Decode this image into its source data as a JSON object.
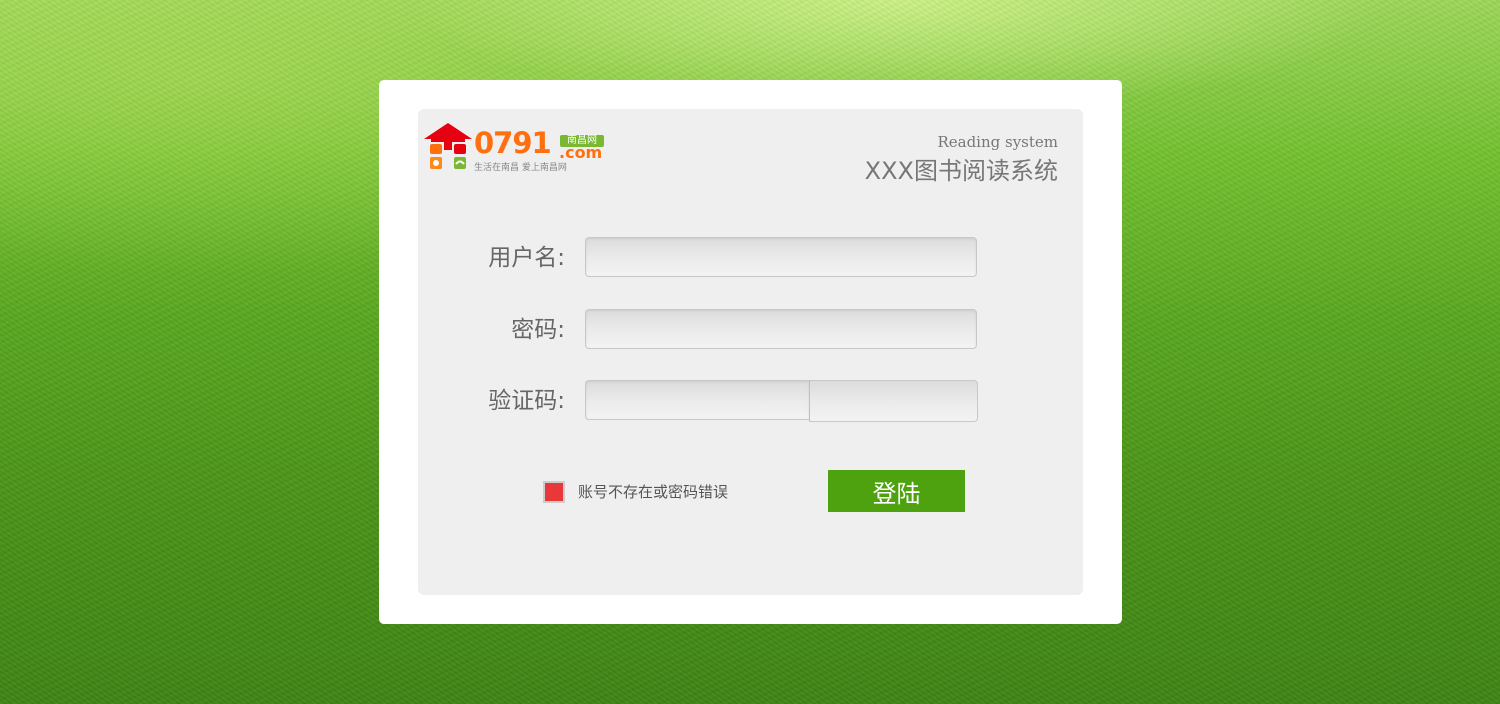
{
  "logo": {
    "number": "0791",
    "badge": "南昌网",
    "domain": ".com",
    "slogan": "生活在南昌  爱上南昌网"
  },
  "header": {
    "subtitle": "Reading system",
    "title": "XXX图书阅读系统"
  },
  "form": {
    "username_label": "用户名:",
    "username_value": "",
    "password_label": "密码:",
    "password_value": "",
    "captcha_label": "验证码:",
    "captcha_value": ""
  },
  "error": {
    "message": "账号不存在或密码错误",
    "color": "#e8383a"
  },
  "login_button": {
    "label": "登陆",
    "color": "#4ea20f"
  }
}
